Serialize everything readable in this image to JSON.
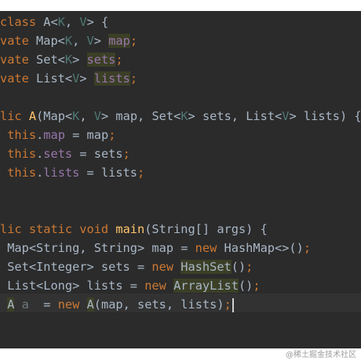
{
  "editor": {
    "lines": [
      {
        "tokens": [
          {
            "t": "class",
            "c": "kw"
          },
          {
            "t": " A<",
            "c": ""
          },
          {
            "t": "K",
            "c": "tp"
          },
          {
            "t": ", ",
            "c": ""
          },
          {
            "t": "V",
            "c": "tp"
          },
          {
            "t": "> {",
            "c": ""
          }
        ]
      },
      {
        "tokens": [
          {
            "t": "vate",
            "c": "kw"
          },
          {
            "t": " Map<",
            "c": ""
          },
          {
            "t": "K",
            "c": "tp"
          },
          {
            "t": ", ",
            "c": ""
          },
          {
            "t": "V",
            "c": "tp"
          },
          {
            "t": "> ",
            "c": ""
          },
          {
            "t": "map",
            "c": "fld hl"
          },
          {
            "t": ";",
            "c": "punct"
          }
        ]
      },
      {
        "tokens": [
          {
            "t": "vate",
            "c": "kw"
          },
          {
            "t": " Set<",
            "c": ""
          },
          {
            "t": "K",
            "c": "tp"
          },
          {
            "t": "> ",
            "c": ""
          },
          {
            "t": "sets",
            "c": "fld hl"
          },
          {
            "t": ";",
            "c": "punct"
          }
        ]
      },
      {
        "tokens": [
          {
            "t": "vate",
            "c": "kw"
          },
          {
            "t": " List<",
            "c": ""
          },
          {
            "t": "V",
            "c": "tp"
          },
          {
            "t": "> ",
            "c": ""
          },
          {
            "t": "lists",
            "c": "fld hl"
          },
          {
            "t": ";",
            "c": "punct"
          }
        ]
      },
      {
        "tokens": []
      },
      {
        "tokens": [
          {
            "t": "lic",
            "c": "kw"
          },
          {
            "t": " ",
            "c": ""
          },
          {
            "t": "A",
            "c": "fn"
          },
          {
            "t": "(Map<",
            "c": ""
          },
          {
            "t": "K",
            "c": "tp"
          },
          {
            "t": ", ",
            "c": ""
          },
          {
            "t": "V",
            "c": "tp"
          },
          {
            "t": "> map, Set<",
            "c": ""
          },
          {
            "t": "K",
            "c": "tp"
          },
          {
            "t": "> sets, List<",
            "c": ""
          },
          {
            "t": "V",
            "c": "tp"
          },
          {
            "t": "> lists) {",
            "c": ""
          }
        ]
      },
      {
        "tokens": [
          {
            "t": " ",
            "c": ""
          },
          {
            "t": "this",
            "c": "kw"
          },
          {
            "t": ".",
            "c": ""
          },
          {
            "t": "map",
            "c": "fld"
          },
          {
            "t": " = map",
            "c": ""
          },
          {
            "t": ";",
            "c": "punct"
          }
        ]
      },
      {
        "tokens": [
          {
            "t": " ",
            "c": ""
          },
          {
            "t": "this",
            "c": "kw"
          },
          {
            "t": ".",
            "c": ""
          },
          {
            "t": "sets",
            "c": "fld"
          },
          {
            "t": " = sets",
            "c": ""
          },
          {
            "t": ";",
            "c": "punct"
          }
        ]
      },
      {
        "tokens": [
          {
            "t": " ",
            "c": ""
          },
          {
            "t": "this",
            "c": "kw"
          },
          {
            "t": ".",
            "c": ""
          },
          {
            "t": "lists",
            "c": "fld"
          },
          {
            "t": " = lists",
            "c": ""
          },
          {
            "t": ";",
            "c": "punct"
          }
        ]
      },
      {
        "tokens": []
      },
      {
        "tokens": []
      },
      {
        "tokens": [
          {
            "t": "lic static void",
            "c": "kw"
          },
          {
            "t": " ",
            "c": ""
          },
          {
            "t": "main",
            "c": "fn"
          },
          {
            "t": "(String[] args) {",
            "c": ""
          }
        ]
      },
      {
        "tokens": [
          {
            "t": " Map<String, String> map = ",
            "c": ""
          },
          {
            "t": "new",
            "c": "kw"
          },
          {
            "t": " HashMap<>()",
            "c": ""
          },
          {
            "t": ";",
            "c": "punct"
          }
        ]
      },
      {
        "tokens": [
          {
            "t": " Set<Integer> sets = ",
            "c": ""
          },
          {
            "t": "new",
            "c": "kw"
          },
          {
            "t": " ",
            "c": ""
          },
          {
            "t": "HashSet",
            "c": "hl"
          },
          {
            "t": "()",
            "c": ""
          },
          {
            "t": ";",
            "c": "punct"
          }
        ]
      },
      {
        "tokens": [
          {
            "t": " List<Long> lists = ",
            "c": ""
          },
          {
            "t": "new",
            "c": "kw"
          },
          {
            "t": " ",
            "c": ""
          },
          {
            "t": "ArrayList",
            "c": "hl"
          },
          {
            "t": "()",
            "c": ""
          },
          {
            "t": ";",
            "c": "punct"
          }
        ]
      },
      {
        "tokens": [
          {
            "t": " ",
            "c": ""
          },
          {
            "t": "A",
            "c": "hl"
          },
          {
            "t": " ",
            "c": ""
          },
          {
            "t": "a",
            "c": "dim"
          },
          {
            "t": "  = ",
            "c": ""
          },
          {
            "t": "new",
            "c": "kw"
          },
          {
            "t": " ",
            "c": ""
          },
          {
            "t": "A",
            "c": "hl"
          },
          {
            "t": "(map, sets, lists)",
            "c": ""
          },
          {
            "t": ";",
            "c": "punct"
          }
        ],
        "caret": true
      }
    ]
  },
  "watermark": "@稀土掘金技术社区"
}
